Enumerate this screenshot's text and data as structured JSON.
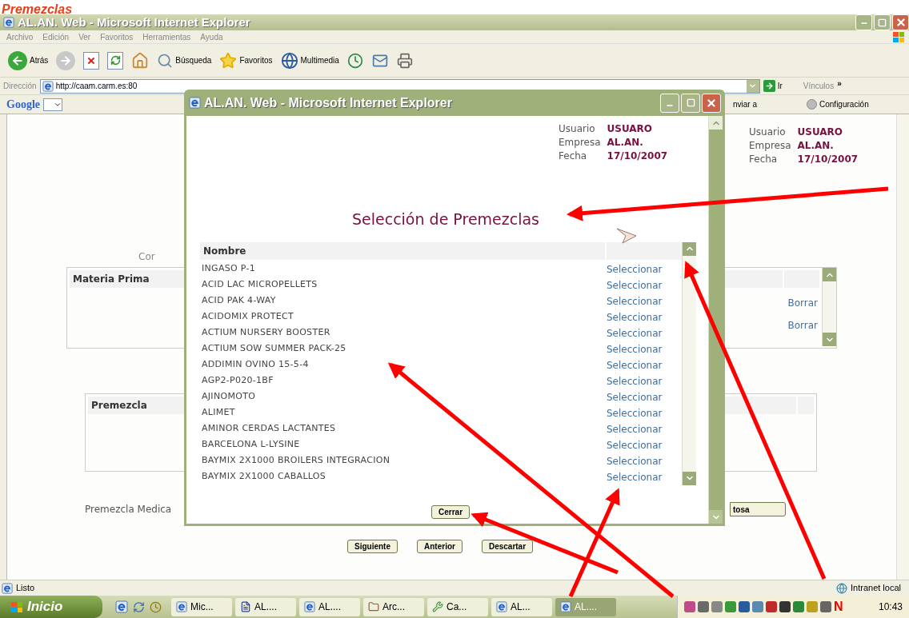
{
  "heading": "Premezclas",
  "browser": {
    "title": "AL.AN. Web - Microsoft Internet Explorer",
    "menu": [
      "Archivo",
      "Edición",
      "Ver",
      "Favoritos",
      "Herramientas",
      "Ayuda"
    ],
    "toolbar": [
      {
        "kind": "back",
        "label": "Atrás"
      },
      {
        "kind": "forward"
      },
      {
        "kind": "stop"
      },
      {
        "kind": "refresh"
      },
      {
        "kind": "home"
      },
      {
        "kind": "search",
        "label": "Búsqueda"
      },
      {
        "kind": "favorites",
        "label": "Favoritos"
      },
      {
        "kind": "media",
        "label": "Multimedia"
      },
      {
        "kind": "history"
      },
      {
        "kind": "mail"
      },
      {
        "kind": "print"
      }
    ],
    "address": {
      "label": "Dirección",
      "value": "http://caam.carm.es:80",
      "go": "Ir",
      "links": "Vínculos",
      "more": "»"
    },
    "google": {
      "logo": "Google",
      "send": "nviar a",
      "settings": "Configuración"
    }
  },
  "page": {
    "user": [
      {
        "label": "Usuario",
        "value": "USUARO"
      },
      {
        "label": "Empresa",
        "value": "AL.AN."
      },
      {
        "label": "Fecha",
        "value": "17/10/2007"
      }
    ],
    "caption": "Cor",
    "materia_table": {
      "column": "Materia Prima",
      "rows": [
        "Borrar",
        "Borrar"
      ]
    },
    "premezcla_table": {
      "column": "Premezcla"
    },
    "medicated_label": "Premezcla Medica",
    "medicated_button": "tosa",
    "buttons": [
      "Siguiente",
      "Anterior",
      "Descartar"
    ]
  },
  "popup": {
    "title": "AL.AN. Web - Microsoft Internet Explorer",
    "user": [
      {
        "label": "Usuario",
        "value": "USUARO"
      },
      {
        "label": "Empresa",
        "value": "AL.AN."
      },
      {
        "label": "Fecha",
        "value": "17/10/2007"
      }
    ],
    "heading": "Selección de Premezclas",
    "column": "Nombre",
    "rows": [
      {
        "name": "INGASO P-1",
        "action": "Seleccionar"
      },
      {
        "name": "ACID LAC MICROPELLETS",
        "action": "Seleccionar"
      },
      {
        "name": "ACID PAK 4-WAY",
        "action": "Seleccionar"
      },
      {
        "name": "ACIDOMIX PROTECT",
        "action": "Seleccionar"
      },
      {
        "name": "ACTIUM NURSERY BOOSTER",
        "action": "Seleccionar"
      },
      {
        "name": "ACTIUM SOW SUMMER PACK-25",
        "action": "Seleccionar"
      },
      {
        "name": "ADDIMIN OVINO 15-5-4",
        "action": "Seleccionar"
      },
      {
        "name": "AGP2-P020-1BF",
        "action": "Seleccionar"
      },
      {
        "name": "AJINOMOTO",
        "action": "Seleccionar"
      },
      {
        "name": "ALIMET",
        "action": "Seleccionar"
      },
      {
        "name": "AMINOR CERDAS LACTANTES",
        "action": "Seleccionar"
      },
      {
        "name": "BARCELONA L-LYSINE",
        "action": "Seleccionar"
      },
      {
        "name": "BAYMIX 2X1000 BROILERS INTEGRACION",
        "action": "Seleccionar"
      },
      {
        "name": "BAYMIX 2X1000 CABALLOS",
        "action": "Seleccionar"
      }
    ],
    "close": "Cerrar"
  },
  "status_bar": {
    "text": "Listo",
    "zone": "Intranet local"
  },
  "taskbar": {
    "start": "Inicio",
    "tasks": [
      {
        "kind": "ie",
        "label": "Mic...",
        "selected": false
      },
      {
        "kind": "word",
        "label": "AL....",
        "selected": false
      },
      {
        "kind": "ie",
        "label": "AL....",
        "selected": false
      },
      {
        "kind": "folder",
        "label": "Arc...",
        "selected": false
      },
      {
        "kind": "tool",
        "label": "Ca...",
        "selected": false
      },
      {
        "kind": "ie",
        "label": "AL...",
        "selected": false
      },
      {
        "kind": "ie",
        "label": "AL....",
        "selected": true
      }
    ],
    "tray_mark": "N",
    "clock": "10:43"
  }
}
